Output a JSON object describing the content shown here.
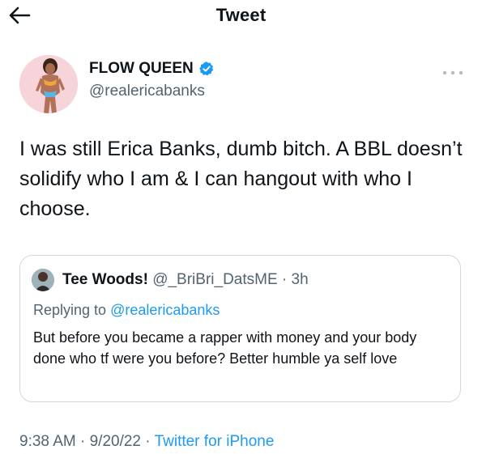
{
  "header": {
    "title": "Tweet",
    "back_icon": "arrow-left-icon"
  },
  "author": {
    "name": "FLOW QUEEN",
    "handle": "@realericabanks",
    "verified_icon": "verified-badge-icon",
    "verified_color": "#1d9bf0",
    "more_icon": "more-horizontal-icon"
  },
  "tweet": {
    "text": "I was still Erica Banks, dumb bitch. A BBL doesn’t solidify who I am & I can hangout with who I choose."
  },
  "quote": {
    "name": "Tee Woods!",
    "handle": "@_BriBri_DatsME",
    "separator": "·",
    "time": "3h",
    "replying_prefix": "Replying to",
    "replying_to": "@realericabanks",
    "text": "But before you became a rapper with money and your body done who tf were you before? Better humble ya self love"
  },
  "meta": {
    "time": "9:38 AM",
    "separator": "·",
    "date": "9/20/22",
    "source": "Twitter for iPhone"
  },
  "colors": {
    "text": "#0f1419",
    "secondary": "#536471",
    "link": "#1d9bf0",
    "border": "#cfd9de"
  }
}
